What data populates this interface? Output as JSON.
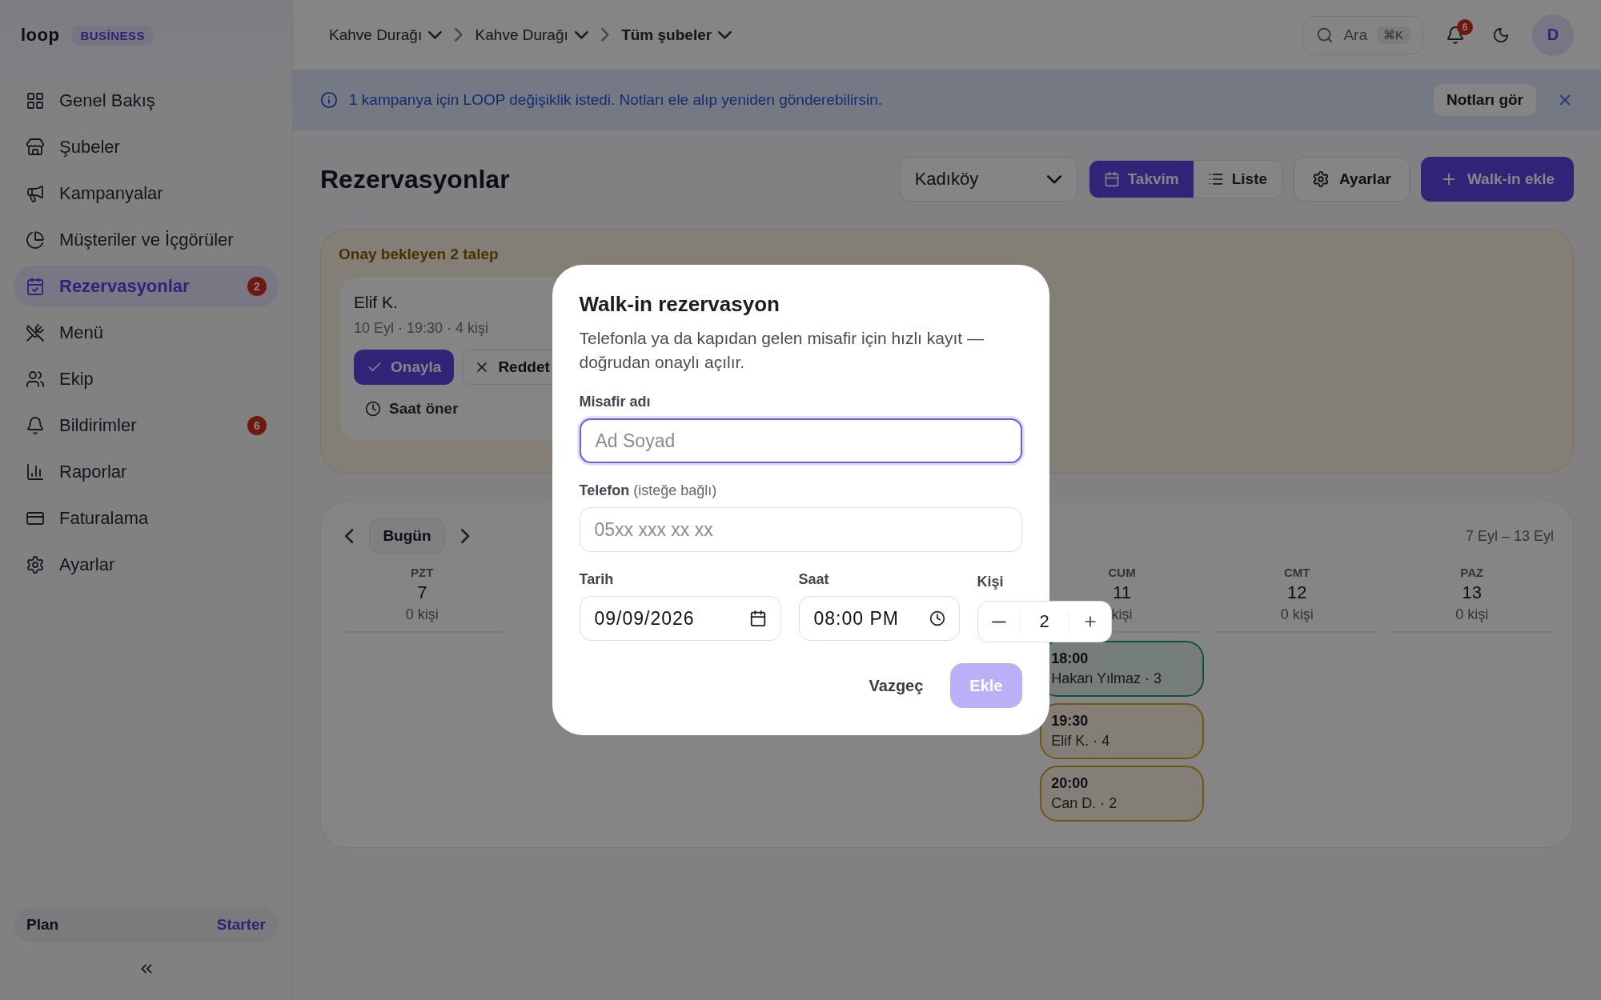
{
  "sidebar": {
    "logo": "loop",
    "badge": "BUSİNESS",
    "items": [
      {
        "label": "Genel Bakış",
        "selected": false
      },
      {
        "label": "Şubeler",
        "selected": false
      },
      {
        "label": "Kampanyalar",
        "selected": false
      },
      {
        "label": "Müşteriler ve İçgörüler",
        "selected": false
      },
      {
        "label": "Rezervasyonlar",
        "selected": true,
        "badge": "2"
      },
      {
        "label": "Menü",
        "selected": false
      },
      {
        "label": "Ekip",
        "selected": false
      },
      {
        "label": "Bildirimler",
        "selected": false,
        "badge": "6"
      },
      {
        "label": "Raporlar",
        "selected": false
      },
      {
        "label": "Faturalama",
        "selected": false
      },
      {
        "label": "Ayarlar",
        "selected": false
      }
    ],
    "plan": {
      "label": "Plan",
      "value": "Starter"
    }
  },
  "topbar": {
    "breadcrumbs": [
      {
        "label": "Kahve Durağı",
        "current": false
      },
      {
        "label": "Kahve Durağı",
        "current": false
      },
      {
        "label": "Tüm şubeler",
        "current": true
      }
    ],
    "search": {
      "placeholder": "Ara",
      "shortcut": "⌘K"
    },
    "notifications": "6",
    "avatar": "D"
  },
  "banner": {
    "text": "1 kampanya için LOOP değişiklik istedi. Notları ele alıp yeniden gönderebilirsin.",
    "action": "Notları gör"
  },
  "page": {
    "title": "Rezervasyonlar",
    "branch": "Kadıköy",
    "views": [
      {
        "label": "Takvim",
        "selected": true
      },
      {
        "label": "Liste",
        "selected": false
      }
    ],
    "settings": "Ayarlar",
    "add": "Walk-in ekle"
  },
  "pending": {
    "title": "Onay bekleyen 2 talep",
    "requests": [
      {
        "name": "Elif K.",
        "details": "10 Eyl · 19:30 · 4 kişi",
        "approve": "Onayla",
        "reject": "Reddet",
        "suggest": "Saat öner"
      }
    ]
  },
  "calendar": {
    "today": "Bugün",
    "range": "7 Eyl – 13 Eyl",
    "days": [
      {
        "weekday": "PZT",
        "date": "7",
        "count": "0 kişi"
      },
      {
        "weekday": "CUM",
        "date": "11",
        "count": "kişi",
        "events": [
          {
            "time": "18:00",
            "guest": "Hakan Yılmaz · 3",
            "kind": "confirmed"
          },
          {
            "time": "19:30",
            "guest": "Elif K. · 4",
            "kind": "pending"
          },
          {
            "time": "20:00",
            "guest": "Can D. · 2",
            "kind": "pending"
          }
        ]
      },
      {
        "weekday": "CMT",
        "date": "12",
        "count": "0 kişi"
      },
      {
        "weekday": "PAZ",
        "date": "13",
        "count": "0 kişi"
      }
    ]
  },
  "modal": {
    "title": "Walk-in rezervasyon",
    "description": "Telefonla ya da kapıdan gelen misafir için hızlı kayıt — doğrudan onaylı açılır.",
    "fields": [
      {
        "label": "Misafir adı",
        "placeholder": "Ad Soyad",
        "focused": true
      },
      {
        "label": "Telefon",
        "hint": "(isteğe bağlı)",
        "placeholder": "05xx xxx xx xx",
        "focused": false
      }
    ],
    "date": {
      "label": "Tarih",
      "value": "09/09/2026"
    },
    "time": {
      "label": "Saat",
      "value": "08:00 PM"
    },
    "guests": {
      "label": "Kişi",
      "value": "2"
    },
    "cancel": "Vazgeç",
    "submit": {
      "label": "Ekle",
      "disabled": true
    }
  }
}
